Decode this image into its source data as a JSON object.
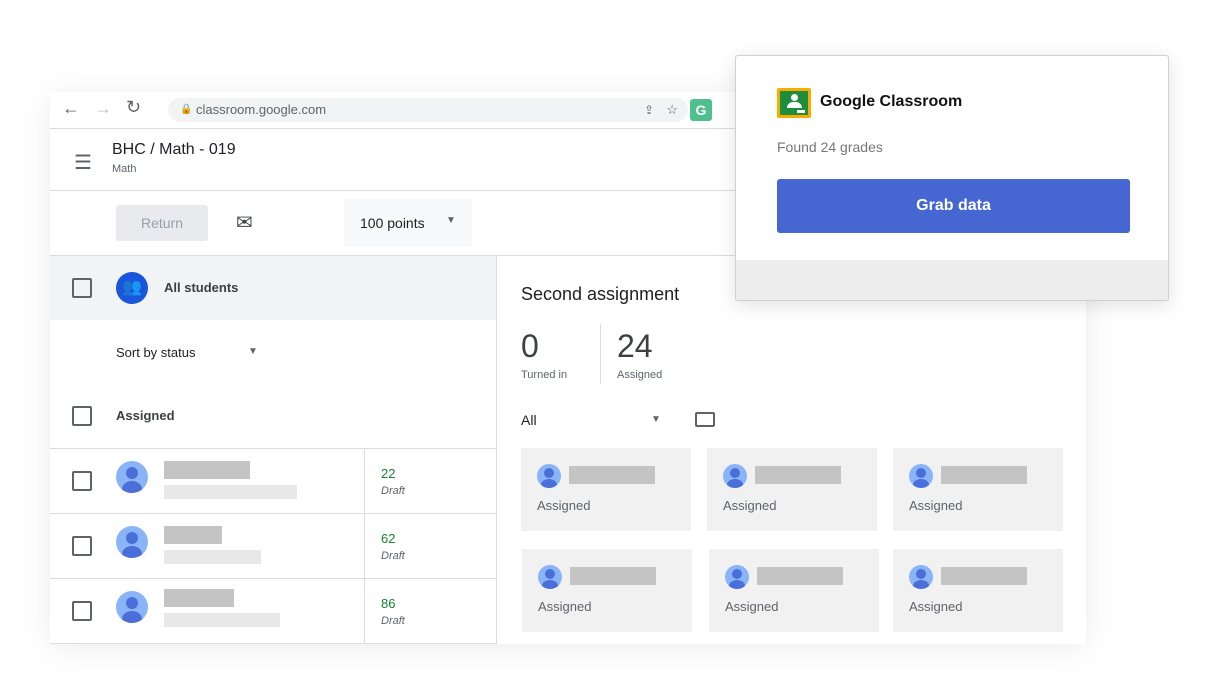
{
  "browser": {
    "url": "classroom.google.com",
    "extension_letter": "G"
  },
  "header": {
    "title": "BHC / Math - 019",
    "subtitle": "Math"
  },
  "toolbar": {
    "return_label": "Return",
    "points_label": "100 points"
  },
  "left": {
    "all_students": "All students",
    "sort_label": "Sort by status",
    "group_label": "Assigned",
    "students": [
      {
        "grade": "22",
        "status": "Draft"
      },
      {
        "grade": "62",
        "status": "Draft"
      },
      {
        "grade": "86",
        "status": "Draft"
      }
    ]
  },
  "assignment": {
    "title": "Second assignment",
    "turned_in_count": "0",
    "turned_in_label": "Turned in",
    "assigned_count": "24",
    "assigned_label": "Assigned",
    "filter_label": "All",
    "cards": [
      {
        "status": "Assigned"
      },
      {
        "status": "Assigned"
      },
      {
        "status": "Assigned"
      },
      {
        "status": "Assigned"
      },
      {
        "status": "Assigned"
      },
      {
        "status": "Assigned"
      }
    ]
  },
  "popup": {
    "app_name": "Google Classroom",
    "found_text": "Found 24 grades",
    "button_label": "Grab data",
    "button_color": "#4666d2"
  }
}
